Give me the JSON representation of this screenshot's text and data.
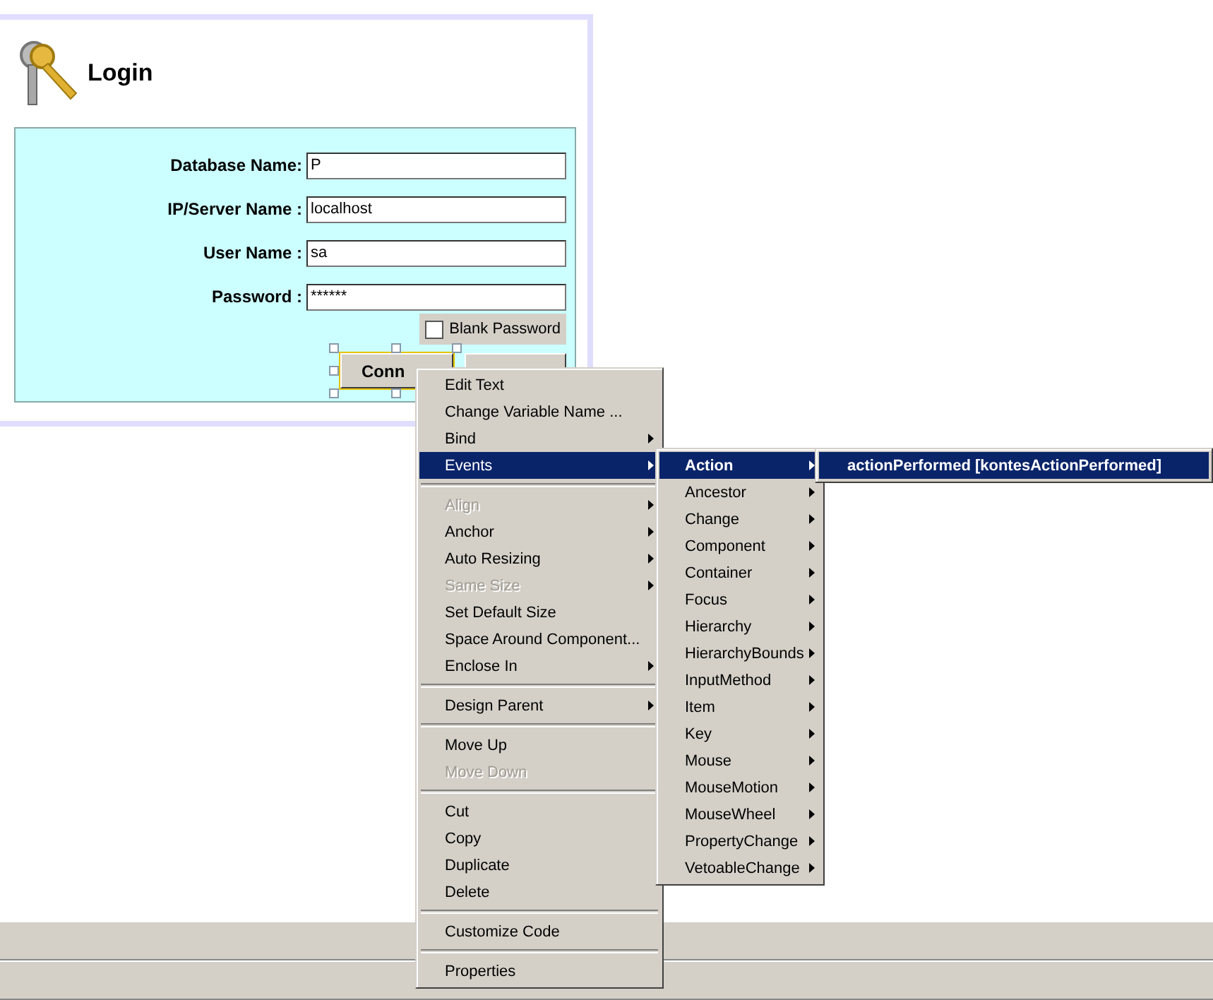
{
  "login": {
    "title": "Login",
    "fields": [
      {
        "label": "Database Name:",
        "value": "P"
      },
      {
        "label": "IP/Server Name :",
        "value": "localhost"
      },
      {
        "label": "User Name :",
        "value": "sa"
      },
      {
        "label": "Password :",
        "value": "******"
      }
    ],
    "blank_password": {
      "label": "Blank Password",
      "checked": false
    },
    "connect_button": "Conn"
  },
  "context_menu": [
    {
      "kind": "item",
      "label": "Edit Text",
      "submenu": false,
      "disabled": false,
      "selected": false
    },
    {
      "kind": "item",
      "label": "Change Variable Name ...",
      "submenu": false,
      "disabled": false,
      "selected": false
    },
    {
      "kind": "item",
      "label": "Bind",
      "submenu": true,
      "disabled": false,
      "selected": false
    },
    {
      "kind": "item",
      "label": "Events",
      "submenu": true,
      "disabled": false,
      "selected": true
    },
    {
      "kind": "separator"
    },
    {
      "kind": "item",
      "label": "Align",
      "submenu": true,
      "disabled": true,
      "selected": false
    },
    {
      "kind": "item",
      "label": "Anchor",
      "submenu": true,
      "disabled": false,
      "selected": false
    },
    {
      "kind": "item",
      "label": "Auto Resizing",
      "submenu": true,
      "disabled": false,
      "selected": false
    },
    {
      "kind": "item",
      "label": "Same Size",
      "submenu": true,
      "disabled": true,
      "selected": false
    },
    {
      "kind": "item",
      "label": "Set Default Size",
      "submenu": false,
      "disabled": false,
      "selected": false
    },
    {
      "kind": "item",
      "label": "Space Around Component...",
      "submenu": false,
      "disabled": false,
      "selected": false
    },
    {
      "kind": "item",
      "label": "Enclose In",
      "submenu": true,
      "disabled": false,
      "selected": false
    },
    {
      "kind": "separator"
    },
    {
      "kind": "item",
      "label": "Design Parent",
      "submenu": true,
      "disabled": false,
      "selected": false
    },
    {
      "kind": "separator"
    },
    {
      "kind": "item",
      "label": "Move Up",
      "submenu": false,
      "disabled": false,
      "selected": false
    },
    {
      "kind": "item",
      "label": "Move Down",
      "submenu": false,
      "disabled": true,
      "selected": false
    },
    {
      "kind": "separator"
    },
    {
      "kind": "item",
      "label": "Cut",
      "submenu": false,
      "disabled": false,
      "selected": false
    },
    {
      "kind": "item",
      "label": "Copy",
      "submenu": false,
      "disabled": false,
      "selected": false
    },
    {
      "kind": "item",
      "label": "Duplicate",
      "submenu": false,
      "disabled": false,
      "selected": false
    },
    {
      "kind": "item",
      "label": "Delete",
      "submenu": false,
      "disabled": false,
      "selected": false
    },
    {
      "kind": "separator"
    },
    {
      "kind": "item",
      "label": "Customize Code",
      "submenu": false,
      "disabled": false,
      "selected": false
    },
    {
      "kind": "separator"
    },
    {
      "kind": "item",
      "label": "Properties",
      "submenu": false,
      "disabled": false,
      "selected": false
    }
  ],
  "events_menu": [
    {
      "label": "Action",
      "selected": true
    },
    {
      "label": "Ancestor",
      "selected": false
    },
    {
      "label": "Change",
      "selected": false
    },
    {
      "label": "Component",
      "selected": false
    },
    {
      "label": "Container",
      "selected": false
    },
    {
      "label": "Focus",
      "selected": false
    },
    {
      "label": "Hierarchy",
      "selected": false
    },
    {
      "label": "HierarchyBounds",
      "selected": false
    },
    {
      "label": "InputMethod",
      "selected": false
    },
    {
      "label": "Item",
      "selected": false
    },
    {
      "label": "Key",
      "selected": false
    },
    {
      "label": "Mouse",
      "selected": false
    },
    {
      "label": "MouseMotion",
      "selected": false
    },
    {
      "label": "MouseWheel",
      "selected": false
    },
    {
      "label": "PropertyChange",
      "selected": false
    },
    {
      "label": "VetoableChange",
      "selected": false
    }
  ],
  "action_menu": [
    {
      "label": "actionPerformed [kontesActionPerformed]",
      "selected": true
    }
  ]
}
